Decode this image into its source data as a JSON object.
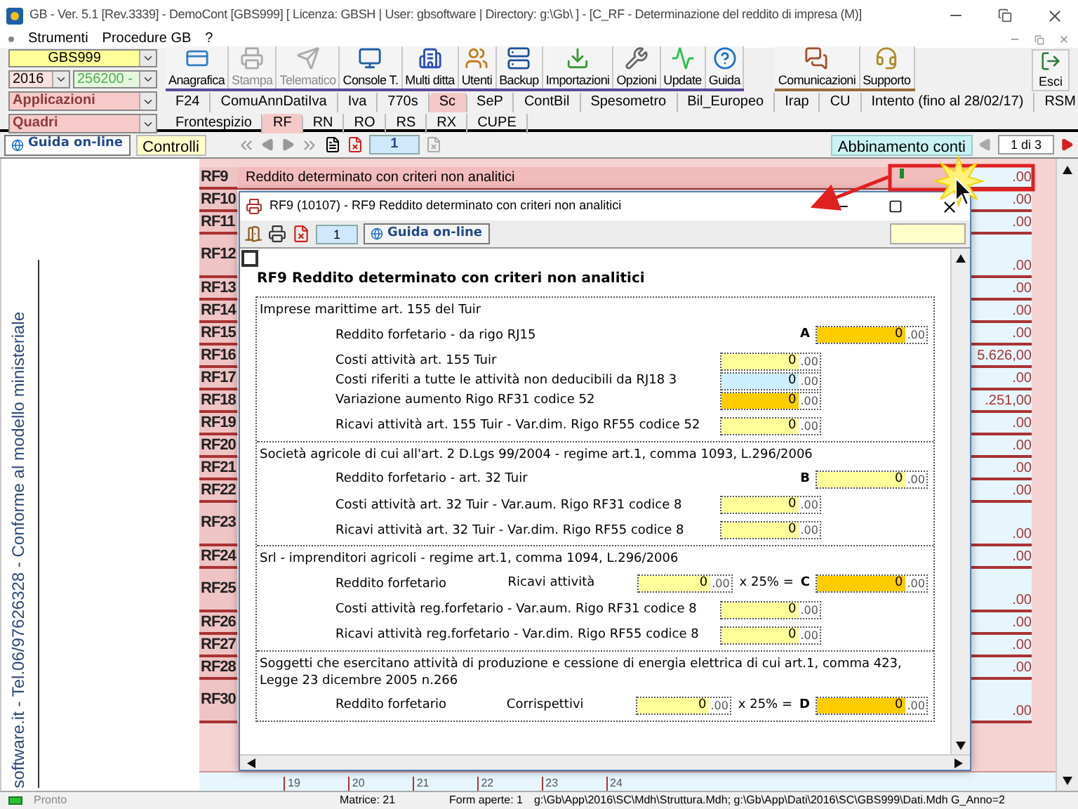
{
  "window": {
    "title": "GB - Ver. 5.1 [Rev.3339] -  DemoCont [GBS999]     [ Licenza: GBSH | User: gbsoftware | Directory: g:\\Gb\\ ] - [C_RF - Determinazione del reddito di impresa (M)]"
  },
  "menu": [
    "Strumenti",
    "Procedure GB",
    "?"
  ],
  "company": {
    "code": "GBS999",
    "year": "2016",
    "account": "256200 -",
    "applications": "Applicazioni",
    "sections": "Quadri"
  },
  "toolbar": [
    {
      "label": "Anagrafica",
      "disabled": false
    },
    {
      "label": "Stampa",
      "disabled": true
    },
    {
      "label": "Telematico",
      "disabled": true
    },
    {
      "label": "Console T.",
      "disabled": false
    },
    {
      "label": "Multi ditta",
      "disabled": false
    },
    {
      "label": "Utenti",
      "disabled": false
    },
    {
      "label": "Backup",
      "disabled": false
    },
    {
      "label": "Importazioni",
      "disabled": false
    },
    {
      "label": "Opzioni",
      "disabled": false
    },
    {
      "label": "Update",
      "disabled": false
    },
    {
      "label": "Guida",
      "disabled": false
    }
  ],
  "toolbar_right": [
    {
      "label": "Comunicazioni",
      "disabled": false
    },
    {
      "label": "Supporto",
      "disabled": false
    }
  ],
  "exit": {
    "label": "Esci"
  },
  "app_tabs": [
    {
      "label": "F24",
      "selected": false
    },
    {
      "label": "ComuAnnDatiIva",
      "selected": false
    },
    {
      "label": "Iva",
      "selected": false
    },
    {
      "label": "770s",
      "selected": false
    },
    {
      "label": "Sc",
      "selected": true
    },
    {
      "label": "SeP",
      "selected": false
    },
    {
      "label": "ContBil",
      "selected": false
    },
    {
      "label": "Spesometro",
      "selected": false
    },
    {
      "label": "Bil_Europeo",
      "selected": false
    },
    {
      "label": "Irap",
      "selected": false
    },
    {
      "label": "CU",
      "selected": false
    },
    {
      "label": "Intento (fino al 28/02/17)",
      "selected": false
    },
    {
      "label": "RSM",
      "selected": false
    }
  ],
  "quadri_tabs": [
    {
      "label": "Frontespizio",
      "selected": false
    },
    {
      "label": "RF",
      "selected": true
    },
    {
      "label": "RN",
      "selected": false
    },
    {
      "label": "RO",
      "selected": false
    },
    {
      "label": "RS",
      "selected": false
    },
    {
      "label": "RX",
      "selected": false
    },
    {
      "label": "CUPE",
      "selected": false
    }
  ],
  "nav": {
    "help": "Guida on-line",
    "checks": "Controlli",
    "page": "1",
    "accounts": "Abbinamento conti",
    "pager": "1 di 3"
  },
  "side_note": "software.it - Tel.06/97626328 - Conforme al modello ministeriale",
  "rows": [
    {
      "code": "RF9",
      "description": "Reddito determinato con criteri non analitici",
      "value": ".00",
      "selected": true,
      "tall": false
    },
    {
      "code": "RF10",
      "value": ".00",
      "selected": false,
      "tall": false
    },
    {
      "code": "RF11",
      "value": ".00",
      "selected": false,
      "tall": false
    },
    {
      "code": "RF12",
      "value": ".00",
      "selected": false,
      "tall": true
    },
    {
      "code": "RF13",
      "value": ".00",
      "selected": false,
      "tall": false
    },
    {
      "code": "RF14",
      "value": ".00",
      "selected": false,
      "tall": false
    },
    {
      "code": "RF15",
      "value": ".00",
      "selected": false,
      "tall": false
    },
    {
      "code": "RF16",
      "value": "5.626,00",
      "selected": false,
      "tall": false
    },
    {
      "code": "RF17",
      "value": ".00",
      "selected": false,
      "tall": false
    },
    {
      "code": "RF18",
      "value": ".251,00",
      "selected": false,
      "tall": false
    },
    {
      "code": "RF19",
      "value": ".00",
      "selected": false,
      "tall": false
    },
    {
      "code": "RF20",
      "value": ".00",
      "selected": false,
      "tall": false
    },
    {
      "code": "RF21",
      "value": ".00",
      "selected": false,
      "tall": false
    },
    {
      "code": "RF22",
      "value": ".00",
      "selected": false,
      "tall": false
    },
    {
      "code": "RF23",
      "value": ".00",
      "selected": false,
      "tall": true
    },
    {
      "code": "RF24",
      "value": ".00",
      "selected": false,
      "tall": false
    },
    {
      "code": "RF25",
      "value": ".00",
      "selected": false,
      "tall": true
    },
    {
      "code": "RF26",
      "value": ".00",
      "selected": false,
      "tall": false
    },
    {
      "code": "RF27",
      "value": ".00",
      "selected": false,
      "tall": false
    },
    {
      "code": "RF28",
      "value": ".00",
      "selected": false,
      "tall": false
    },
    {
      "code": "RF30",
      "value": ".00",
      "selected": false,
      "tall": true
    }
  ],
  "bottom_strip": [
    "19",
    "20",
    "21",
    "22",
    "23",
    "24"
  ],
  "dialog": {
    "title": "RF9 (10107) - RF9 Reddito determinato con criteri non analitici",
    "page": "1",
    "help": "Guida on-line",
    "checked": false,
    "heading": "RF9 Reddito determinato con criteri non analitici",
    "sections": [
      {
        "title": "Imprese marittime art. 155 del Tuir",
        "groups": [
          [
            {
              "kind": "total",
              "label": "Reddito forfetario - da rigo RJ15",
              "letter": "A",
              "result": {
                "value": "0",
                "decimals": ".00",
                "kind": "total"
              }
            }
          ],
          [
            {
              "kind": "amount",
              "label": "Costi attività art. 155 Tuir",
              "input": {
                "value": "0",
                "decimals": ".00",
                "kind": "input"
              }
            },
            {
              "kind": "amount",
              "label": "Costi riferiti a tutte le attività non deducibili da RJ18  3",
              "input": {
                "value": "0",
                "decimals": ".00",
                "kind": "computed"
              }
            },
            {
              "kind": "amount",
              "label": "Variazione aumento Rigo RF31 codice 52",
              "input": {
                "value": "0",
                "decimals": ".00",
                "kind": "total"
              }
            }
          ],
          [
            {
              "kind": "amount",
              "label": "Ricavi attività art. 155 Tuir - Var.dim. Rigo RF55 codice 52",
              "input": {
                "value": "0",
                "decimals": ".00",
                "kind": "input"
              }
            }
          ]
        ]
      },
      {
        "title": "Società agricole di cui all'art. 2 D.Lgs 99/2004 - regime art.1, comma 1093, L.296/2006",
        "groups": [
          [
            {
              "kind": "total",
              "label": "Reddito forfetario - art. 32 Tuir",
              "letter": "B",
              "result": {
                "value": "0",
                "decimals": ".00",
                "kind": "input"
              }
            }
          ],
          [
            {
              "kind": "amount",
              "label": "Costi attività art. 32 Tuir - Var.aum. Rigo RF31 codice 8",
              "input": {
                "value": "0",
                "decimals": ".00",
                "kind": "input"
              }
            }
          ],
          [
            {
              "kind": "amount",
              "label": "Ricavi attività art. 32 Tuir - Var.dim. Rigo RF55 codice 8",
              "input": {
                "value": "0",
                "decimals": ".00",
                "kind": "input"
              }
            }
          ]
        ]
      },
      {
        "title": "Srl - imprenditori agricoli - regime art.1, comma 1094, L.296/2006",
        "groups": [
          [
            {
              "kind": "formula",
              "label": "Reddito forfetario",
              "sublabel": "Ricavi attività",
              "input": {
                "value": "0",
                "decimals": ".00",
                "kind": "input"
              },
              "operator": "x 25% =",
              "letter": "C",
              "result": {
                "value": "0",
                "decimals": ".00",
                "kind": "total"
              }
            }
          ],
          [
            {
              "kind": "amount",
              "label": "Costi attività reg.forfetario - Var.aum. Rigo RF31 codice 8",
              "input": {
                "value": "0",
                "decimals": ".00",
                "kind": "input"
              }
            }
          ],
          [
            {
              "kind": "amount",
              "label": "Ricavi attività reg.forfetario - Var.dim. Rigo RF55 codice 8",
              "input": {
                "value": "0",
                "decimals": ".00",
                "kind": "input"
              }
            }
          ]
        ]
      },
      {
        "title": "Soggetti che esercitano attività di produzione e cessione di energia elettrica di cui art.1, comma 423, Legge 23 dicembre 2005 n.266",
        "groups": [
          [
            {
              "kind": "formula",
              "label": "Reddito forfetario",
              "sublabel": "Corrispettivi",
              "input": {
                "value": "0",
                "decimals": ".00",
                "kind": "input"
              },
              "operator": "x 25% =",
              "letter": "D",
              "result": {
                "value": "0",
                "decimals": ".00",
                "kind": "total"
              }
            }
          ]
        ]
      }
    ]
  },
  "status_bar": {
    "state": "Pronto",
    "matrix": "Matrice: 21",
    "forms": "Form aperte: 1",
    "path": "g:\\Gb\\App\\2016\\SC\\Mdh\\Struttura.Mdh; g:\\Gb\\App\\Dati\\2016\\SC\\GBS999\\Dati.Mdh G_Anno=2"
  }
}
